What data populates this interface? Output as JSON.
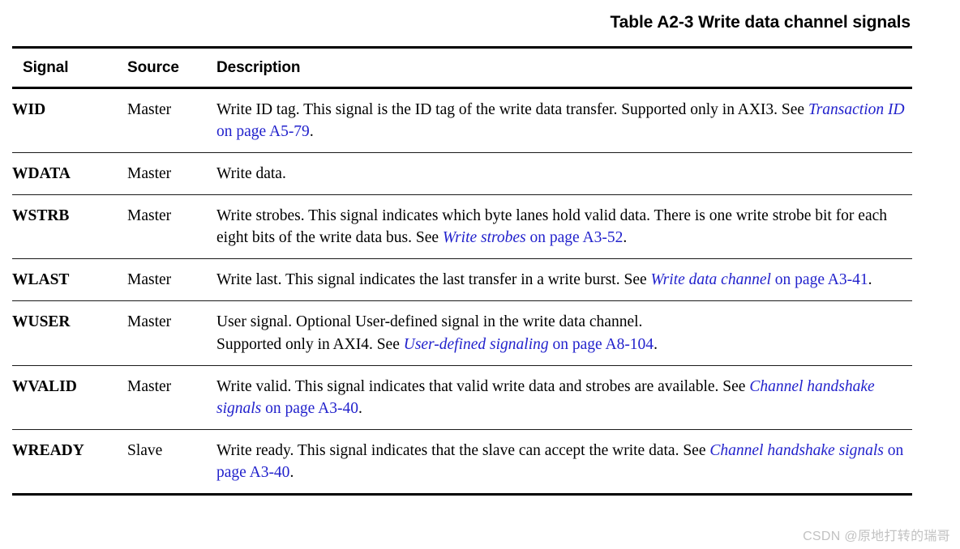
{
  "title": "Table A2-3 Write data channel signals",
  "columns": {
    "signal": "Signal",
    "source": "Source",
    "description": "Description"
  },
  "rows": [
    {
      "signal": "WID",
      "source": "Master",
      "lines": [
        {
          "pre": "Write ID tag. This signal is the ID tag of the write data transfer. Supported only in AXI3. See ",
          "xref_title": "Transaction ID",
          "xref_page": " on page A5-79",
          "post": "."
        }
      ]
    },
    {
      "signal": "WDATA",
      "source": "Master",
      "lines": [
        {
          "pre": "Write data.",
          "xref_title": "",
          "xref_page": "",
          "post": ""
        }
      ]
    },
    {
      "signal": "WSTRB",
      "source": "Master",
      "lines": [
        {
          "pre": "Write strobes. This signal indicates which byte lanes hold valid data. There is one write strobe bit for each eight bits of the write data bus. See ",
          "xref_title": "Write strobes",
          "xref_page": " on page A3-52",
          "post": "."
        }
      ]
    },
    {
      "signal": "WLAST",
      "source": "Master",
      "lines": [
        {
          "pre": "Write last. This signal indicates the last transfer in a write burst. See ",
          "xref_title": "Write data channel",
          "xref_page": " on page A3-41",
          "post": "."
        }
      ]
    },
    {
      "signal": "WUSER",
      "source": "Master",
      "lines": [
        {
          "pre": "User signal. Optional User-defined signal in the write data channel.",
          "xref_title": "",
          "xref_page": "",
          "post": ""
        },
        {
          "pre": "Supported only in AXI4. See ",
          "xref_title": "User-defined signaling",
          "xref_page": " on page A8-104",
          "post": "."
        }
      ]
    },
    {
      "signal": "WVALID",
      "source": "Master",
      "lines": [
        {
          "pre": "Write valid. This signal indicates that valid write data and strobes are available. See ",
          "xref_title": "Channel handshake signals",
          "xref_page": " on page A3-40",
          "post": "."
        }
      ]
    },
    {
      "signal": "WREADY",
      "source": "Slave",
      "lines": [
        {
          "pre": "Write ready. This signal indicates that the slave can accept the write data. See ",
          "xref_title": "Channel handshake signals",
          "xref_page": " on page A3-40",
          "post": "."
        }
      ]
    }
  ],
  "watermark": "CSDN @原地打转的瑞哥",
  "colors": {
    "xref_link": "#2222cc",
    "rule": "#000000",
    "watermark": "#c2c2c2"
  }
}
